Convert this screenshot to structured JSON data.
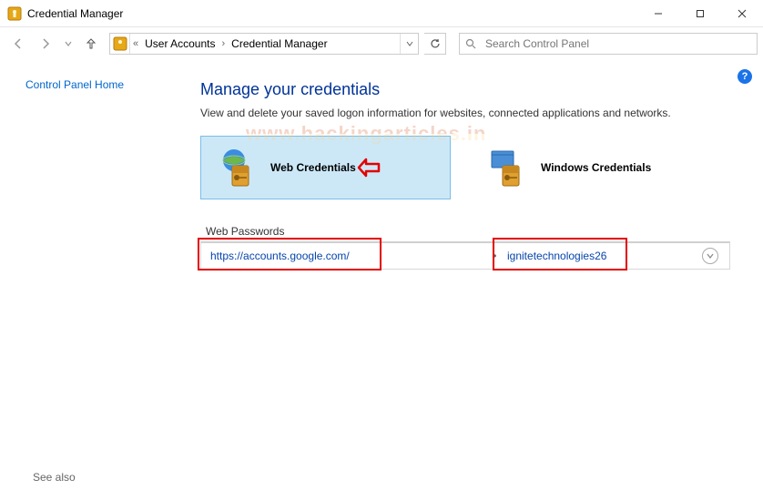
{
  "titlebar": {
    "title": "Credential Manager"
  },
  "breadcrumbs": {
    "level1": "User Accounts",
    "level2": "Credential Manager"
  },
  "search": {
    "placeholder": "Search Control Panel"
  },
  "sidebar": {
    "home_link": "Control Panel Home",
    "see_also": "See also"
  },
  "heading": "Manage your credentials",
  "subtext": "View and delete your saved logon information for websites, connected applications and networks.",
  "cards": {
    "web": "Web Credentials",
    "windows": "Windows Credentials"
  },
  "section": {
    "web_passwords": "Web Passwords"
  },
  "entry": {
    "url": "https://accounts.google.com/",
    "separator": "•",
    "username": "ignitetechnologies26"
  },
  "watermark": "www.hackingarticles.in",
  "help": "?"
}
